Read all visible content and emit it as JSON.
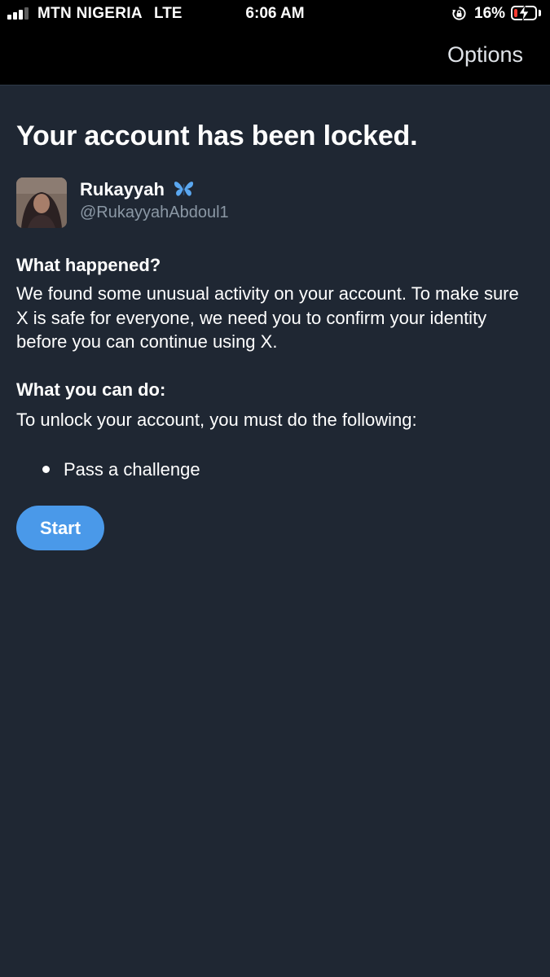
{
  "status_bar": {
    "carrier": "MTN NIGERIA",
    "network": "LTE",
    "time": "6:06 AM",
    "battery_percent": "16%",
    "signal_bars_filled": 3,
    "signal_bars_total": 4,
    "battery_level": 0.16,
    "battery_color": "#ff3b30"
  },
  "header": {
    "options_label": "Options"
  },
  "main": {
    "title": "Your account has been locked.",
    "user": {
      "display_name": "Rukayyah",
      "handle": "@RukayyahAbdoul1",
      "name_emoji_icon": "butterfly-icon"
    },
    "what_happened": {
      "heading": "What happened?",
      "body": "We found some unusual activity on your account. To make sure X is safe for everyone, we need you to confirm your identity before you can continue using X."
    },
    "what_you_can_do": {
      "heading": "What you can do:",
      "body": "To unlock your account, you must do the following:",
      "steps": [
        "Pass a challenge"
      ]
    },
    "start_button_label": "Start"
  },
  "colors": {
    "background": "#1f2733",
    "top_bar": "#000000",
    "accent_button": "#4a99e9",
    "secondary_text": "#8b98a5"
  }
}
